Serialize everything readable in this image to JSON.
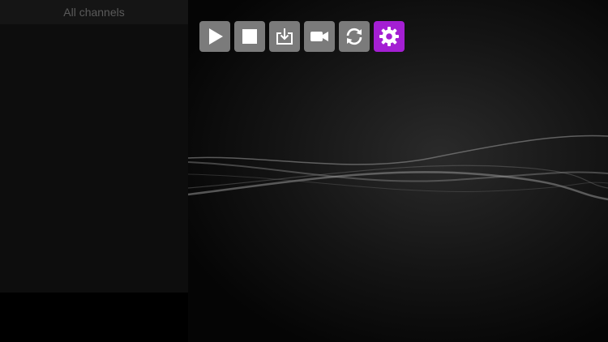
{
  "sidebar": {
    "header_label": "All channels"
  },
  "toolbar": {
    "buttons": [
      {
        "icon": "play-icon",
        "active": false
      },
      {
        "icon": "stop-icon",
        "active": false
      },
      {
        "icon": "download-icon",
        "active": false
      },
      {
        "icon": "video-camera-icon",
        "active": false
      },
      {
        "icon": "refresh-icon",
        "active": false
      },
      {
        "icon": "gear-icon",
        "active": true
      }
    ]
  },
  "colors": {
    "button_bg": "#7b7b7b",
    "button_active_bg": "#a41fd3",
    "icon_color": "#ffffff",
    "background": "#000000"
  }
}
